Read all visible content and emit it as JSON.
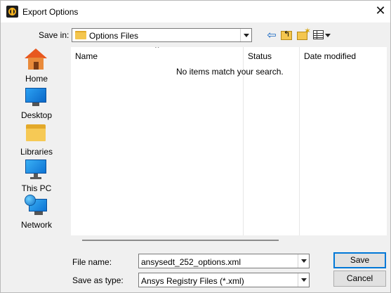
{
  "window": {
    "title": "Export Options",
    "close_glyph": "✕"
  },
  "toolbar": {
    "save_in_label": "Save in:",
    "save_in_value": "Options Files",
    "back_glyph": "⇦",
    "up_glyph": "↰",
    "new_folder_glyph": "✶"
  },
  "places": [
    {
      "label": "Home",
      "icon": "home-icon"
    },
    {
      "label": "Desktop",
      "icon": "desktop-icon"
    },
    {
      "label": "Libraries",
      "icon": "libraries-icon"
    },
    {
      "label": "This PC",
      "icon": "this-pc-icon"
    },
    {
      "label": "Network",
      "icon": "network-icon"
    }
  ],
  "file_list": {
    "columns": [
      "Name",
      "Status",
      "Date modified"
    ],
    "sort_glyph": "^",
    "empty_message": "No items match your search."
  },
  "form": {
    "file_name_label": "File name:",
    "file_name_value": "ansysedt_252_options.xml",
    "save_as_type_label": "Save as type:",
    "save_as_type_value": "Ansys Registry Files (*.xml)"
  },
  "buttons": {
    "save": "Save",
    "cancel": "Cancel"
  }
}
